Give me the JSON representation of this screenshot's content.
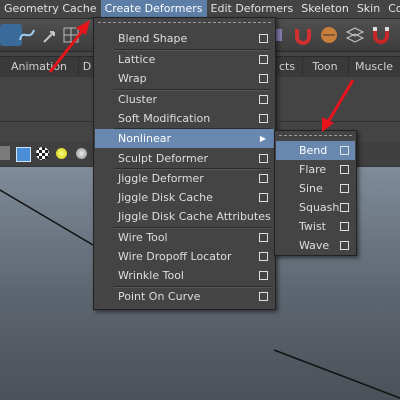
{
  "menubar": {
    "items": [
      "Geometry Cache",
      "Create Deformers",
      "Edit Deformers",
      "Skeleton",
      "Skin",
      "Cons"
    ]
  },
  "shelf": {
    "tabs": [
      "Animation",
      "D",
      "cts",
      "Toon",
      "Muscle"
    ]
  },
  "deformers_menu": {
    "items": [
      {
        "label": "Blend Shape",
        "option_box": true
      },
      {
        "label": "Lattice",
        "option_box": true
      },
      {
        "label": "Wrap",
        "option_box": true
      },
      {
        "label": "Cluster",
        "option_box": true
      },
      {
        "label": "Soft Modification",
        "option_box": true
      },
      {
        "label": "Nonlinear",
        "submenu": true,
        "highlighted": true
      },
      {
        "label": "Sculpt Deformer",
        "option_box": true
      },
      {
        "label": "Jiggle Deformer",
        "option_box": true
      },
      {
        "label": "Jiggle Disk Cache",
        "option_box": true
      },
      {
        "label": "Jiggle Disk Cache Attributes",
        "option_box": false
      },
      {
        "label": "Wire Tool",
        "option_box": true
      },
      {
        "label": "Wire Dropoff Locator",
        "option_box": true
      },
      {
        "label": "Wrinkle Tool",
        "option_box": true
      },
      {
        "label": "Point On Curve",
        "option_box": true
      }
    ]
  },
  "nonlinear_submenu": {
    "items": [
      {
        "label": "Bend",
        "highlighted": true
      },
      {
        "label": "Flare"
      },
      {
        "label": "Sine"
      },
      {
        "label": "Squash"
      },
      {
        "label": "Twist"
      },
      {
        "label": "Wave"
      }
    ]
  },
  "colors": {
    "menu_highlight": "#6888b0",
    "annotation_arrow": "#e8141c",
    "menu_bg": "#444444"
  },
  "icons": [
    "curve-tool-icon",
    "move-icon",
    "magnet-icon",
    "lattice-icon",
    "sphere-icon",
    "checker-icon",
    "light-icon"
  ]
}
